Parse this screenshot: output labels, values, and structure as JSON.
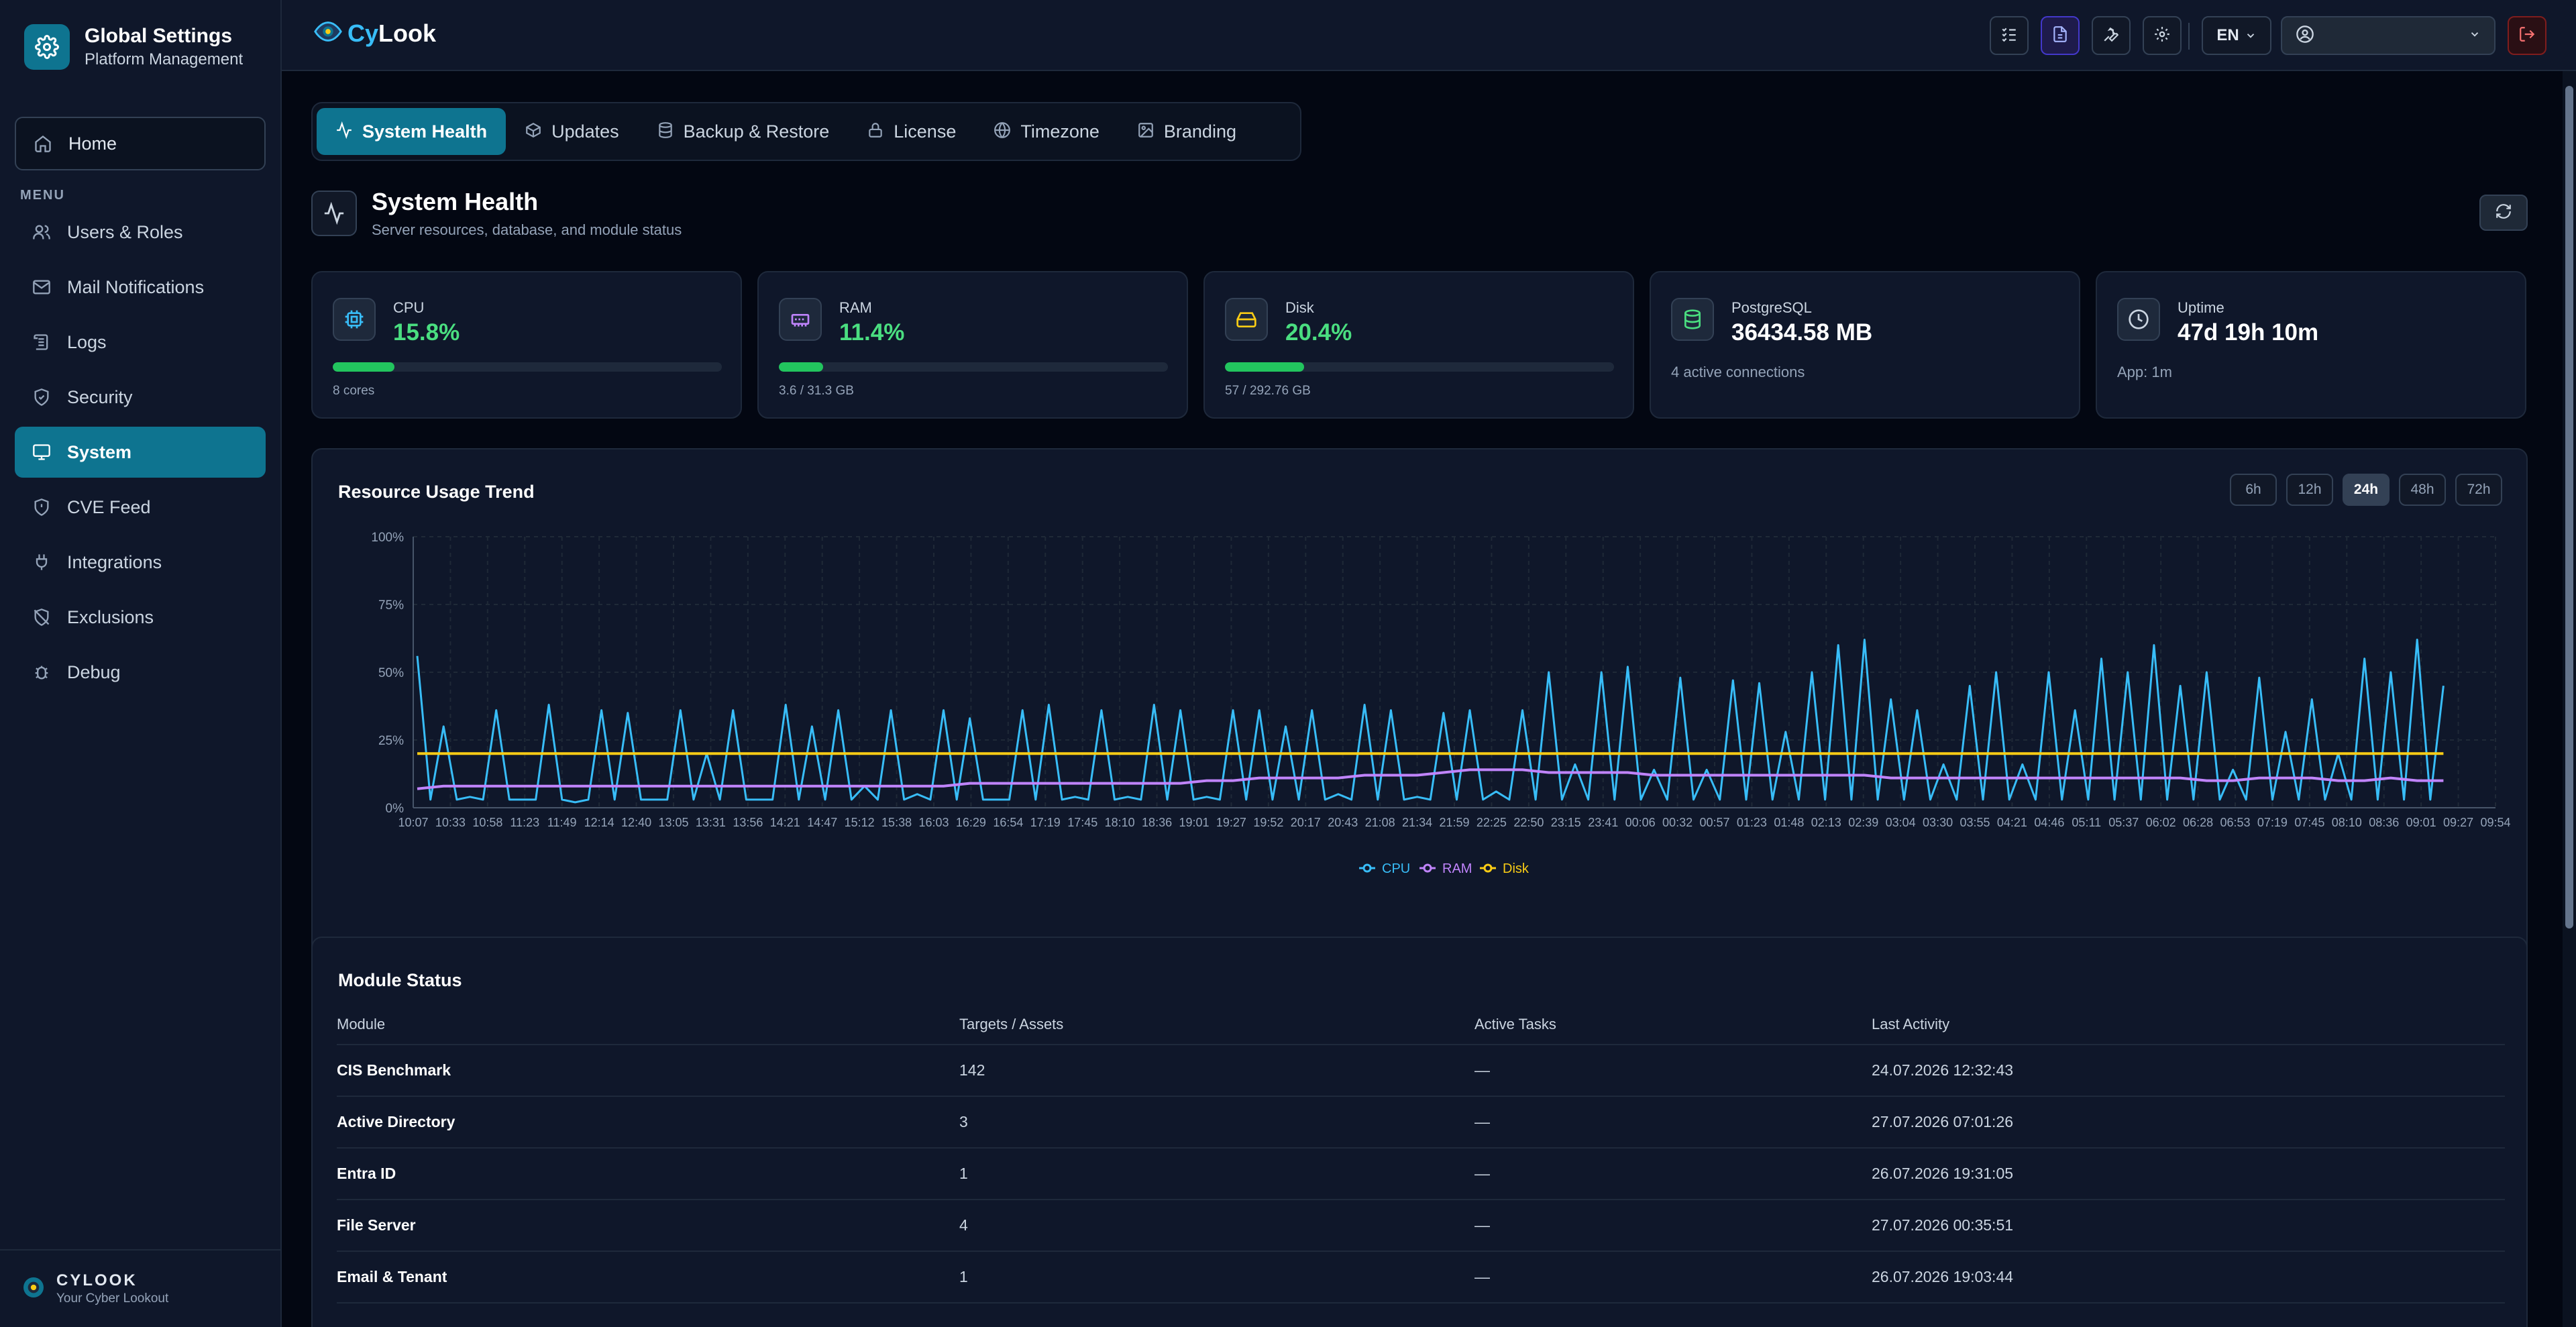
{
  "sidebar": {
    "title": "Global Settings",
    "subtitle": "Platform Management",
    "home_label": "Home",
    "menu_label": "MENU",
    "items": [
      {
        "label": "Users & Roles",
        "icon": "users-icon"
      },
      {
        "label": "Mail Notifications",
        "icon": "mail-icon"
      },
      {
        "label": "Logs",
        "icon": "logs-icon"
      },
      {
        "label": "Security",
        "icon": "shield-icon"
      },
      {
        "label": "System",
        "icon": "monitor-icon",
        "active": true
      },
      {
        "label": "CVE Feed",
        "icon": "shield-alert-icon"
      },
      {
        "label": "Integrations",
        "icon": "plug-icon"
      },
      {
        "label": "Exclusions",
        "icon": "shield-off-icon"
      },
      {
        "label": "Debug",
        "icon": "bug-icon"
      }
    ],
    "footer_brand": "CYLOOK",
    "footer_tagline": "Your Cyber Lookout"
  },
  "topbar": {
    "brand_cy": "Cy",
    "brand_look": "Look",
    "language": "EN",
    "icons": [
      "tasks-icon",
      "document-icon",
      "wrench-icon",
      "gear-icon",
      "logout-icon"
    ]
  },
  "tabs": [
    {
      "label": "System Health",
      "icon": "activity-icon",
      "active": true
    },
    {
      "label": "Updates",
      "icon": "package-icon"
    },
    {
      "label": "Backup & Restore",
      "icon": "database-icon"
    },
    {
      "label": "License",
      "icon": "lock-icon"
    },
    {
      "label": "Timezone",
      "icon": "globe-icon"
    },
    {
      "label": "Branding",
      "icon": "image-icon"
    }
  ],
  "section": {
    "title": "System Health",
    "subtitle": "Server resources, database, and module status"
  },
  "cards": {
    "cpu": {
      "label": "CPU",
      "value": "15.8%",
      "fraction": 0.158,
      "sub": "8 cores"
    },
    "ram": {
      "label": "RAM",
      "value": "11.4%",
      "fraction": 0.114,
      "sub": "3.6 / 31.3 GB"
    },
    "disk": {
      "label": "Disk",
      "value": "20.4%",
      "fraction": 0.204,
      "sub": "57 / 292.76 GB"
    },
    "db": {
      "label": "PostgreSQL",
      "value": "36434.58 MB",
      "sub": "4 active connections"
    },
    "uptime": {
      "label": "Uptime",
      "value": "47d 19h 10m",
      "sub": "App: 1m"
    }
  },
  "trend": {
    "title": "Resource Usage Trend",
    "ranges": [
      "6h",
      "12h",
      "24h",
      "48h",
      "72h"
    ],
    "active_range": "24h"
  },
  "chart_data": {
    "type": "line",
    "ylim": [
      0,
      100
    ],
    "y_ticks": [
      "0%",
      "25%",
      "50%",
      "75%",
      "100%"
    ],
    "x": [
      "10:07",
      "10:33",
      "10:58",
      "11:23",
      "11:49",
      "12:14",
      "12:40",
      "13:05",
      "13:31",
      "13:56",
      "14:21",
      "14:47",
      "15:12",
      "15:38",
      "16:03",
      "16:29",
      "16:54",
      "17:19",
      "17:45",
      "18:10",
      "18:36",
      "19:01",
      "19:27",
      "19:52",
      "20:17",
      "20:43",
      "21:08",
      "21:34",
      "21:59",
      "22:25",
      "22:50",
      "23:15",
      "23:41",
      "00:06",
      "00:32",
      "00:57",
      "01:23",
      "01:48",
      "02:13",
      "02:39",
      "03:04",
      "03:30",
      "03:55",
      "04:21",
      "04:46",
      "05:11",
      "05:37",
      "06:02",
      "06:28",
      "06:53",
      "07:19",
      "07:45",
      "08:10",
      "08:36",
      "09:01",
      "09:27",
      "09:54"
    ],
    "series": [
      {
        "name": "CPU",
        "color": "#38bdf8",
        "values": [
          56,
          30,
          4,
          36,
          3,
          38,
          2,
          36,
          35,
          3,
          36,
          20,
          36,
          3,
          38,
          30,
          36,
          8,
          36,
          5,
          36,
          33,
          3,
          36,
          38,
          4,
          36,
          4,
          38,
          36,
          4,
          36,
          36,
          30,
          36,
          5,
          38,
          36,
          4,
          35,
          36,
          6,
          36,
          50,
          16,
          50,
          52,
          14,
          48,
          14,
          47,
          46,
          28,
          50,
          60,
          62,
          40,
          36,
          16,
          45,
          50,
          16,
          50,
          36,
          55,
          50,
          60,
          45,
          50,
          14,
          48,
          28,
          40,
          20,
          55,
          50,
          62,
          45
        ]
      },
      {
        "name": "RAM",
        "color": "#c084fc",
        "values": [
          7,
          8,
          8,
          8,
          8,
          8,
          8,
          8,
          8,
          8,
          8,
          8,
          8,
          8,
          8,
          8,
          8,
          8,
          8,
          8,
          8,
          9,
          9,
          9,
          9,
          9,
          9,
          9,
          9,
          9,
          10,
          10,
          11,
          11,
          11,
          11,
          12,
          12,
          12,
          13,
          14,
          14,
          14,
          13,
          13,
          13,
          13,
          12,
          12,
          12,
          12,
          12,
          12,
          12,
          12,
          12,
          11,
          11,
          11,
          11,
          11,
          11,
          11,
          11,
          11,
          11,
          11,
          11,
          10,
          10,
          11,
          11,
          11,
          10,
          10,
          11,
          10,
          10
        ]
      },
      {
        "name": "Disk",
        "color": "#facc15",
        "values": [
          20,
          20,
          20,
          20,
          20,
          20,
          20,
          20,
          20,
          20,
          20,
          20,
          20,
          20,
          20,
          20,
          20,
          20,
          20,
          20,
          20,
          20,
          20,
          20,
          20,
          20,
          20,
          20,
          20,
          20,
          20,
          20,
          20,
          20,
          20,
          20,
          20,
          20,
          20,
          20,
          20,
          20,
          20,
          20,
          20,
          20,
          20,
          20,
          20,
          20,
          20,
          20,
          20,
          20,
          20,
          20,
          20,
          20,
          20,
          20,
          20,
          20,
          20,
          20,
          20,
          20,
          20,
          20,
          20,
          20,
          20,
          20,
          20,
          20,
          20,
          20,
          20,
          20
        ]
      }
    ],
    "legend": "bottom"
  },
  "modules": {
    "title": "Module Status",
    "columns": [
      "Module",
      "Targets / Assets",
      "Active Tasks",
      "Last Activity"
    ],
    "rows": [
      {
        "name": "CIS Benchmark",
        "targets": "142",
        "tasks": "—",
        "last": "24.07.2026 12:32:43"
      },
      {
        "name": "Active Directory",
        "targets": "3",
        "tasks": "—",
        "last": "27.07.2026 07:01:26"
      },
      {
        "name": "Entra ID",
        "targets": "1",
        "tasks": "—",
        "last": "26.07.2026 19:31:05"
      },
      {
        "name": "File Server",
        "targets": "4",
        "tasks": "—",
        "last": "27.07.2026 00:35:51"
      },
      {
        "name": "Email & Tenant",
        "targets": "1",
        "tasks": "—",
        "last": "26.07.2026 19:03:44"
      }
    ]
  }
}
